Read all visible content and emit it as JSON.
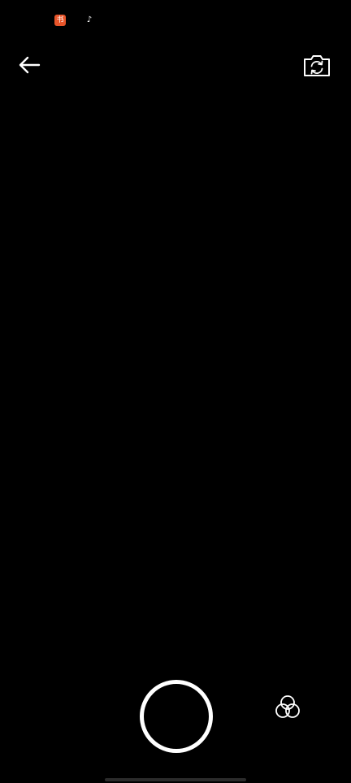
{
  "status_bar": {
    "notifications": [
      {
        "app": "xiaohongshu",
        "icon": "app-notification-icon",
        "glyph": "书",
        "color": "#e8552a"
      },
      {
        "app": "tiktok",
        "icon": "tiktok-icon",
        "glyph": "♪",
        "color": "#000000"
      }
    ]
  },
  "toolbar": {
    "back_icon": "arrow-left-icon",
    "flip_icon": "camera-flip-icon"
  },
  "camera": {
    "shutter_icon": "shutter-ring",
    "filter_icon": "filters-icon"
  },
  "colors": {
    "background": "#000000",
    "foreground": "#ffffff"
  }
}
